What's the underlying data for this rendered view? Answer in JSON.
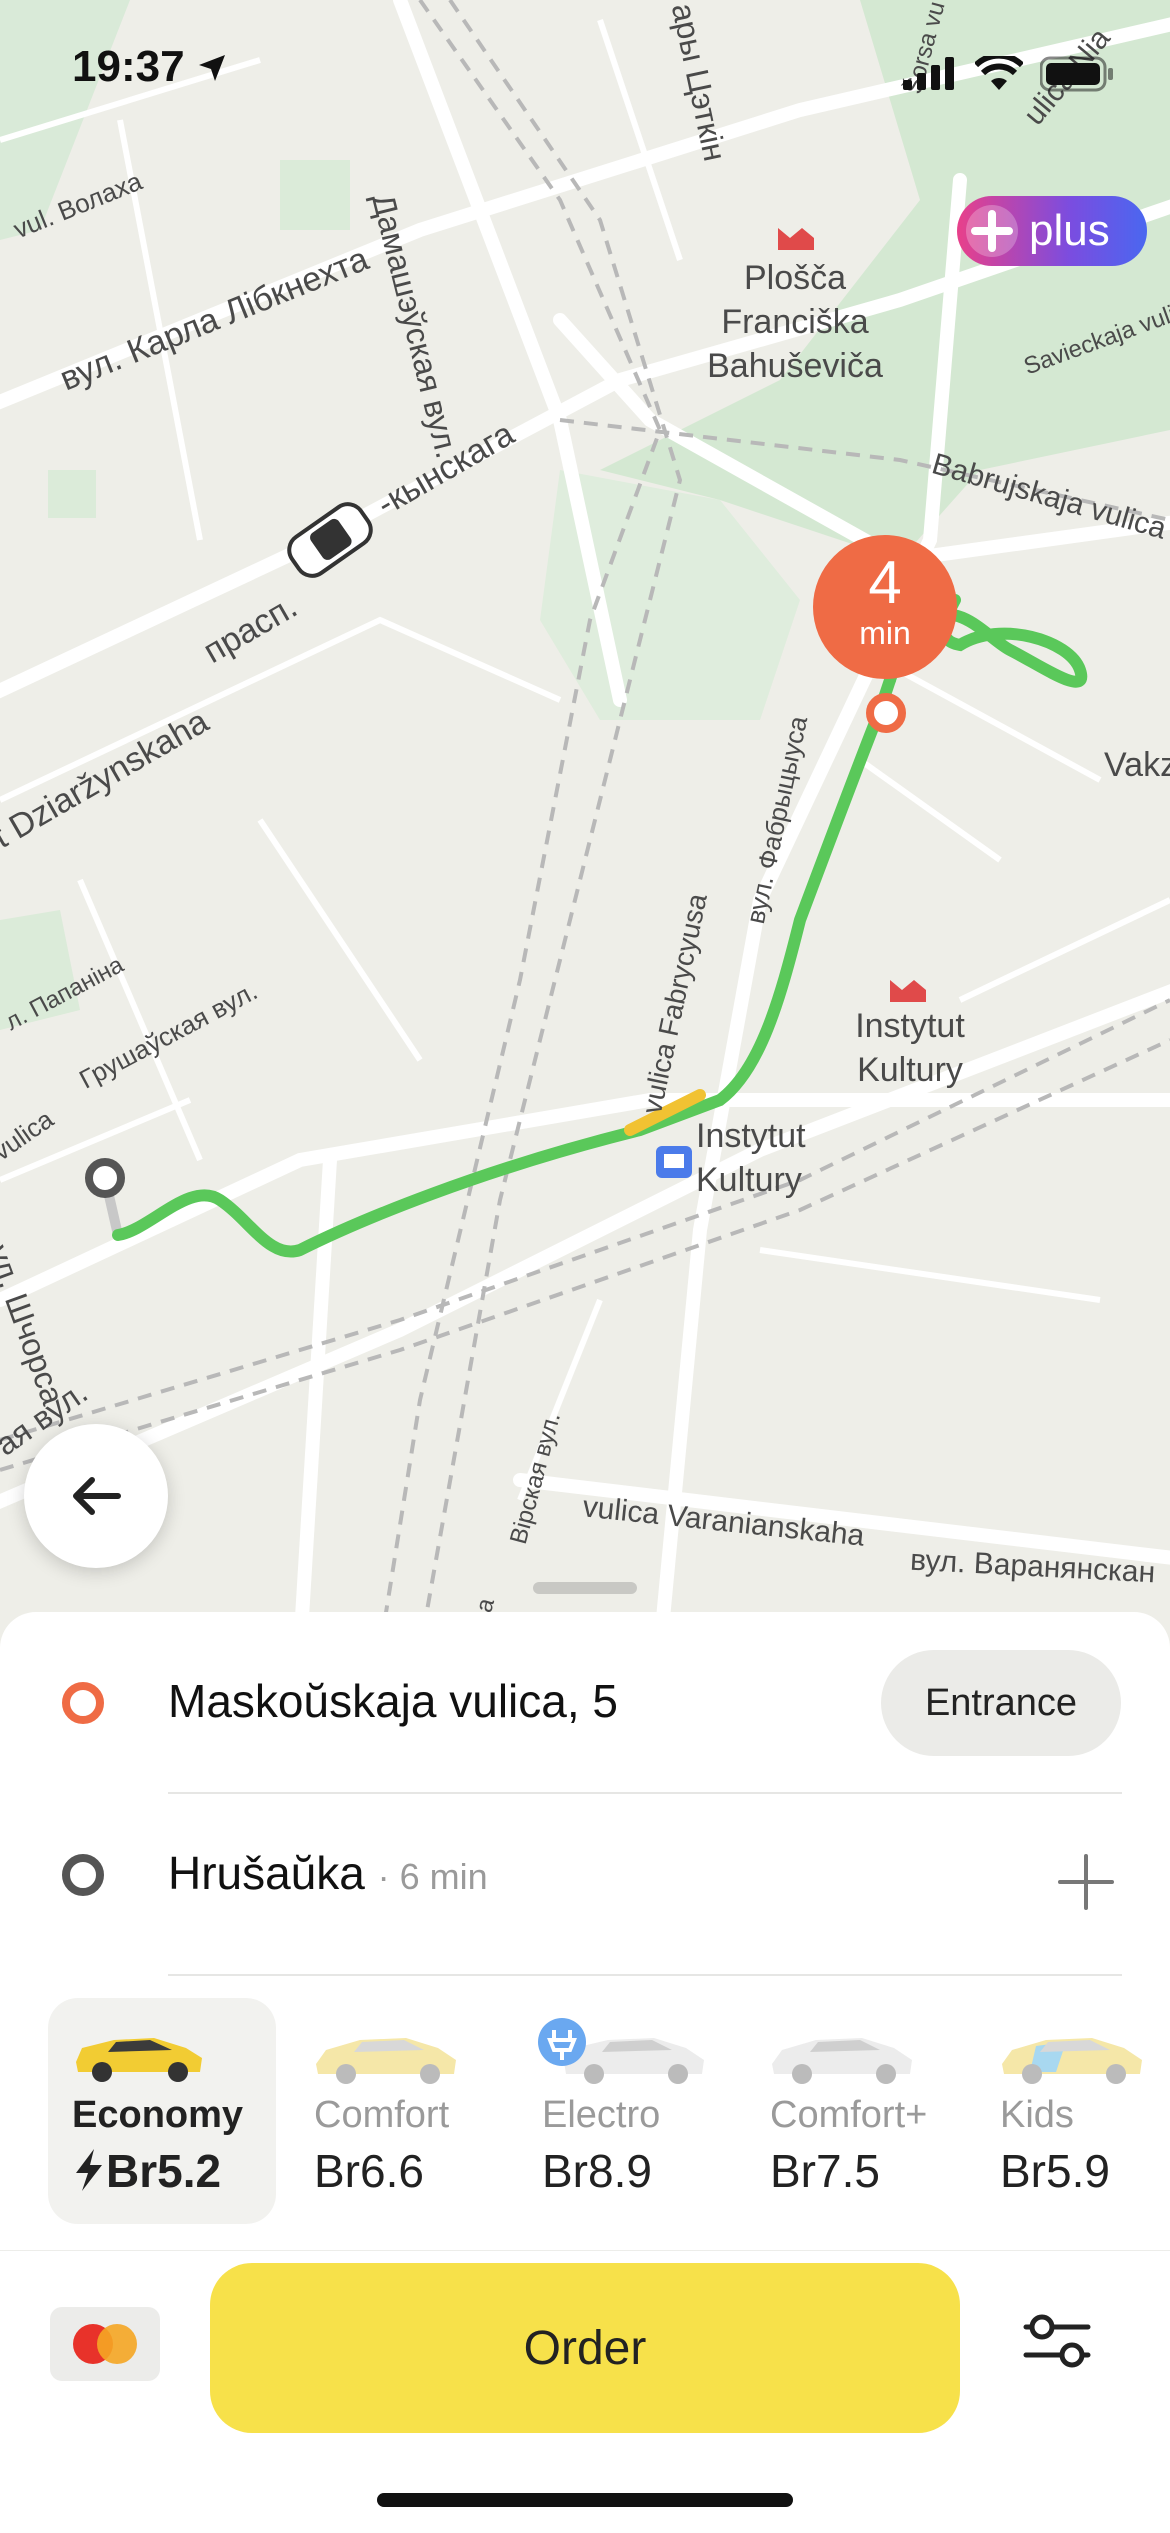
{
  "status_bar": {
    "time": "19:37"
  },
  "plus_badge": {
    "label": "plus"
  },
  "eta_badge": {
    "value": "4",
    "unit": "min"
  },
  "map": {
    "street_labels": [
      "vul. Волаха",
      "вул. Карла Лібкнехта",
      "Дамашэўская вул.",
      "ары Цэткін",
      "Šorsa vu",
      "ulica Nia",
      "Savieckaja vulic",
      "Babrujskaja vulica",
      "ckaja vulica",
      "-кынскага",
      "прасп.",
      "t Dziaržynskaha",
      "вул. Фабрыцыуса",
      "vulica Fabrycyusa",
      "л. Папаніна",
      "Грушаўская вул.",
      "vulica",
      "ул. Шчорса",
      "ая вул.",
      "Вірская вул.",
      "ica",
      "vulica Varanianskaha",
      "вул. Варанянскан",
      "Vakz"
    ],
    "poi": [
      {
        "name": "Plošča Franciška Bahuševiča"
      },
      {
        "name": "Instytut Kultury"
      },
      {
        "name": "Instytut Kultury"
      }
    ]
  },
  "route": {
    "from": {
      "address": "Maskoŭskaja vulica, 5",
      "entrance_label": "Entrance"
    },
    "to": {
      "address": "Hrušaŭka",
      "duration": "· 6 min"
    }
  },
  "tariffs": [
    {
      "name": "Economy",
      "price": "Br5.2",
      "selected": true,
      "surge": true
    },
    {
      "name": "Comfort",
      "price": "Br6.6",
      "selected": false
    },
    {
      "name": "Electro",
      "price": "Br8.9",
      "selected": false
    },
    {
      "name": "Comfort+",
      "price": "Br7.5",
      "selected": false
    },
    {
      "name": "Kids",
      "price": "Br5.9",
      "selected": false
    }
  ],
  "actions": {
    "order_label": "Order"
  },
  "colors": {
    "accent_yellow": "#f7e14a",
    "eta_orange": "#ef6b45",
    "route_green": "#5ac85a",
    "origin_orange": "#ef6b45"
  }
}
